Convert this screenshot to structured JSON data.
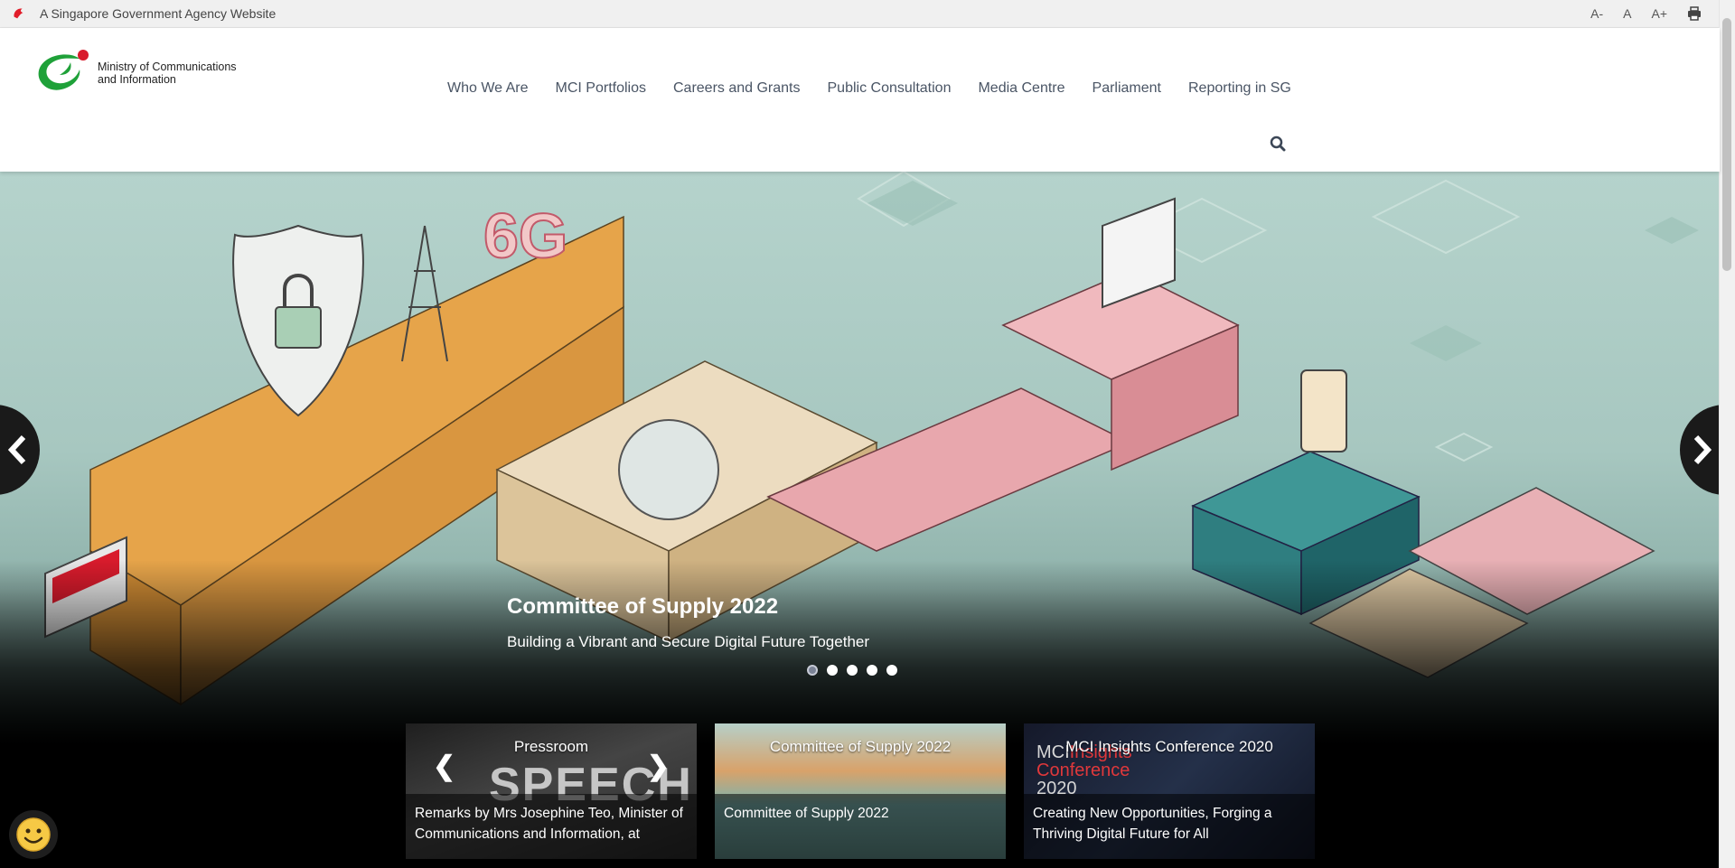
{
  "masthead": {
    "text": "A Singapore Government Agency Website"
  },
  "a11y": {
    "decrease": "A-",
    "reset": "A",
    "increase": "A+"
  },
  "logo": {
    "line1": "Ministry of Communications",
    "line2": "and Information"
  },
  "nav": [
    "Who We Are",
    "MCI Portfolios",
    "Careers and Grants",
    "Public Consultation",
    "Media Centre",
    "Parliament",
    "Reporting in SG"
  ],
  "hero": {
    "title": "Committee of Supply 2022",
    "subtitle": "Building a Vibrant and Secure Digital Future Together",
    "slide_count": 5,
    "active_slide": 1
  },
  "cards": [
    {
      "title": "Pressroom",
      "body": "Remarks by Mrs Josephine Teo, Minister of Communications and Information, at",
      "image_text": "SPEECH"
    },
    {
      "title": "Committee of Supply 2022",
      "body": "Committee of Supply 2022"
    },
    {
      "title": "MCI Insights Conference 2020",
      "body": "Creating New Opportunities, Forging a Thriving Digital Future for All",
      "image_text_a": "MCI",
      "image_text_b": "Insights",
      "image_text_c": "Conference",
      "image_text_d": "2020"
    }
  ],
  "colors": {
    "brand_green": "#1fa139",
    "brand_red": "#d81b2c",
    "nav_text": "#4a5565"
  }
}
